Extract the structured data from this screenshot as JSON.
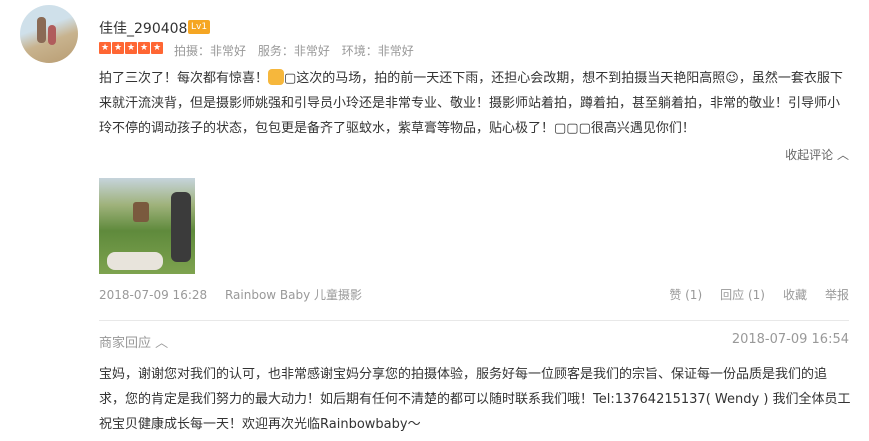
{
  "user": {
    "name": "佳佳_290408",
    "level": "Lv1"
  },
  "rating": {
    "stars": 5,
    "scores": [
      "拍摄：非常好",
      "服务：非常好",
      "环境：非常好"
    ]
  },
  "review": {
    "part1": "拍了三次了！每次都有惊喜！",
    "part2": "▢这次的马场，拍的前一天还下雨，还担心会改期，想不到拍摄当天艳阳高照😉，虽然一套衣服下来就汗流浃背，但是摄影师姚强和引导员小玲还是非常专业、敬业！摄影师站着拍，蹲着拍，甚至躺着拍，非常的敬业！引导师小玲不停的调动孩子的状态，包包更是备齐了驱蚊水，紫草膏等物品，贴心极了！▢▢▢很高兴遇见你们！",
    "collapse_label": "收起评论 ︿"
  },
  "meta": {
    "date": "2018-07-09 16:28",
    "merchant": "Rainbow Baby 儿童摄影"
  },
  "actions": {
    "like": "赞 (1)",
    "reply": "回应 (1)",
    "favorite": "收藏",
    "report": "举报"
  },
  "merchant_reply": {
    "label": "商家回应 ︿",
    "time": "2018-07-09 16:54",
    "text": "宝妈，谢谢您对我们的认可，也非常感谢宝妈分享您的拍摄体验，服务好每一位顾客是我们的宗旨、保证每一份品质是我们的追求，您的肯定是我们努力的最大动力！如后期有任何不清楚的都可以随时联系我们哦！Tel:13764215137( Wendy ) 我们全体员工祝宝贝健康成长每一天！欢迎再次光临Rainbowbaby～"
  },
  "colors": {
    "accent_star": "#ff6633",
    "level_badge": "#f5a623",
    "muted_text": "#999999"
  },
  "icons": {
    "thumbs_up_emoji": "thumbs-up-icon",
    "star": "star-icon"
  }
}
